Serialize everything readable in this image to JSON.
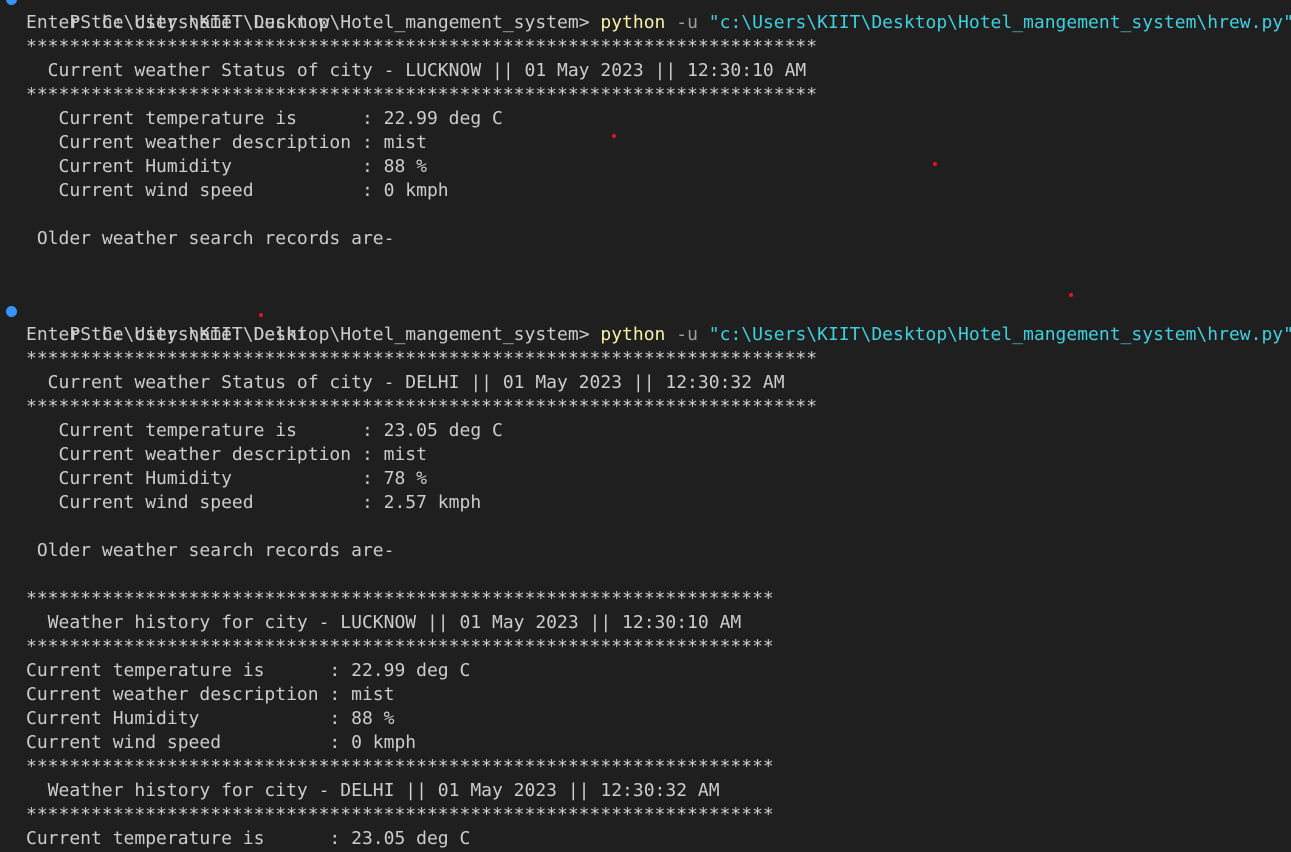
{
  "prompt": "PS C:\\Users\\KIIT\\Desktop\\Hotel_mangement_system> ",
  "command": {
    "program": "python",
    "flag": " -u ",
    "path": "\"c:\\Users\\KIIT\\Desktop\\Hotel_mangement_system\\hrew.py\""
  },
  "run1": {
    "input": "Enter the city name: Lucknow",
    "stars": "*************************************************************************",
    "header": "  Current weather Status of city - LUCKNOW || 01 May 2023 || 12:30:10 AM",
    "rows": [
      "   Current temperature is      : 22.99 deg C",
      "   Current weather description : mist",
      "   Current Humidity            : 88 %",
      "   Current wind speed          : 0 kmph"
    ],
    "older": " Older weather search records are-"
  },
  "run2": {
    "input": "Enter the city name: Delhi",
    "stars": "*************************************************************************",
    "header": "  Current weather Status of city - DELHI || 01 May 2023 || 12:30:32 AM",
    "rows": [
      "   Current temperature is      : 23.05 deg C",
      "   Current weather description : mist",
      "   Current Humidity            : 78 %",
      "   Current wind speed          : 2.57 kmph"
    ],
    "older": " Older weather search records are-"
  },
  "history": {
    "stars": "*********************************************************************",
    "lucknow": {
      "header": "  Weather history for city - LUCKNOW || 01 May 2023 || 12:30:10 AM",
      "rows": [
        "Current temperature is      : 22.99 deg C",
        "Current weather description : mist",
        "Current Humidity            : 88 %",
        "Current wind speed          : 0 kmph"
      ]
    },
    "delhi": {
      "header": "  Weather history for city - DELHI || 01 May 2023 || 12:30:32 AM",
      "rows": [
        "Current temperature is      : 23.05 deg C"
      ]
    }
  },
  "colors": {
    "background": "#1f1f1f",
    "text": "#cccccc",
    "python": "#f9f1a5",
    "path": "#3fd0e0",
    "dot": "#3794ff"
  }
}
